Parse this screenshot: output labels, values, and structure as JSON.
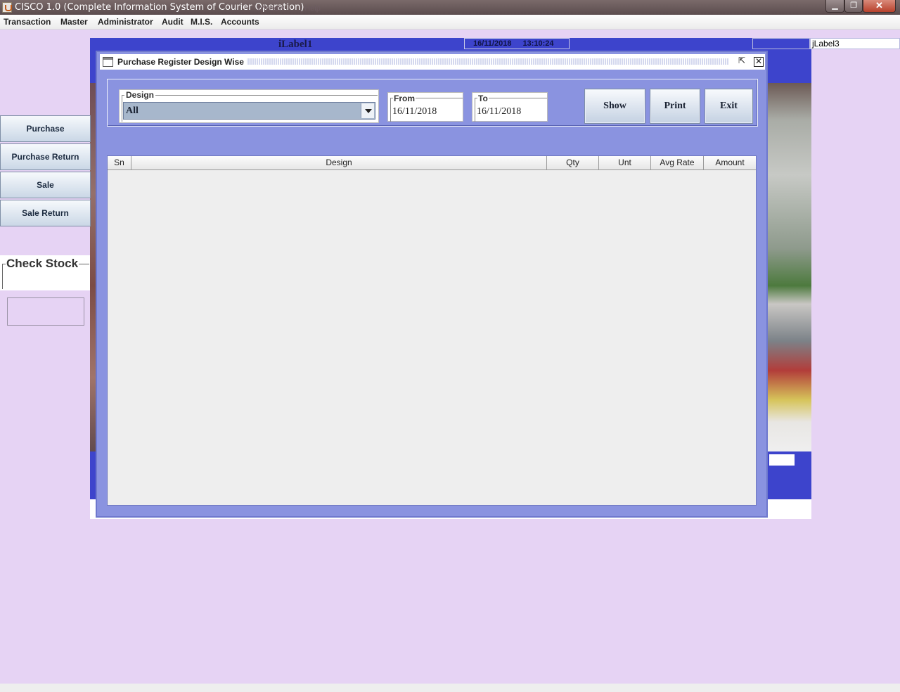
{
  "window": {
    "title": "CISCO 1.0 (Complete Information System of Courier Operation)",
    "faded_menu": [
      "Window",
      "Help"
    ]
  },
  "menu": {
    "items": [
      "Transaction",
      "Master",
      "Administrator",
      "Audit",
      "M.I.S.",
      "Accounts"
    ]
  },
  "background": {
    "label1": "iLabel1",
    "date": "16/11/2018",
    "time": "13:10:24",
    "label3": "jLabel3"
  },
  "sidebar": {
    "buttons": [
      "Purchase",
      "Purchase Return",
      "Sale",
      "Sale Return"
    ],
    "check_stock_title": "Check Stock"
  },
  "dialog": {
    "title": "Purchase Register Design Wise",
    "design_label": "Design",
    "design_value": "All",
    "from_label": "From",
    "from_value": "16/11/2018",
    "to_label": "To",
    "to_value": "16/11/2018",
    "show_label": "Show",
    "print_label": "Print",
    "exit_label": "Exit",
    "columns": [
      "Sn",
      "Design",
      "Qty",
      "Unt",
      "Avg Rate",
      "Amount"
    ],
    "rows": []
  },
  "colors": {
    "desktop": "#e6d3f4",
    "frame_blue": "#3d44cc",
    "dialog_bg": "#8a93e0"
  }
}
